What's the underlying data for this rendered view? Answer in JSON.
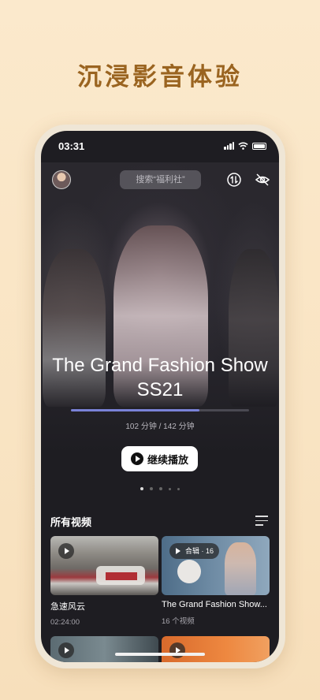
{
  "headline": "沉浸影音体验",
  "status_bar": {
    "time": "03:31"
  },
  "header": {
    "search_placeholder": "搜索“福利社”",
    "avatar_icon": "user-avatar",
    "sync_icon": "sort-arrows-icon",
    "hide_icon": "eye-off-icon"
  },
  "hero": {
    "title": "The Grand Fashion Show SS21",
    "progress_fraction": 0.72,
    "progress_text": "102 分钟 / 142 分钟",
    "continue_label": "继续播放"
  },
  "carousel": {
    "count": 5,
    "active_index": 0
  },
  "section": {
    "title": "所有视频"
  },
  "videos": [
    {
      "title": "急速风云",
      "meta": "02:24:00",
      "badge": ""
    },
    {
      "title": "The Grand Fashion Show...",
      "meta": "16 个视频",
      "badge": "合辑 · 16"
    }
  ],
  "colors": {
    "accent": "#7a82d8",
    "headline": "#9a6420",
    "screen_bg": "#1e1d22"
  }
}
